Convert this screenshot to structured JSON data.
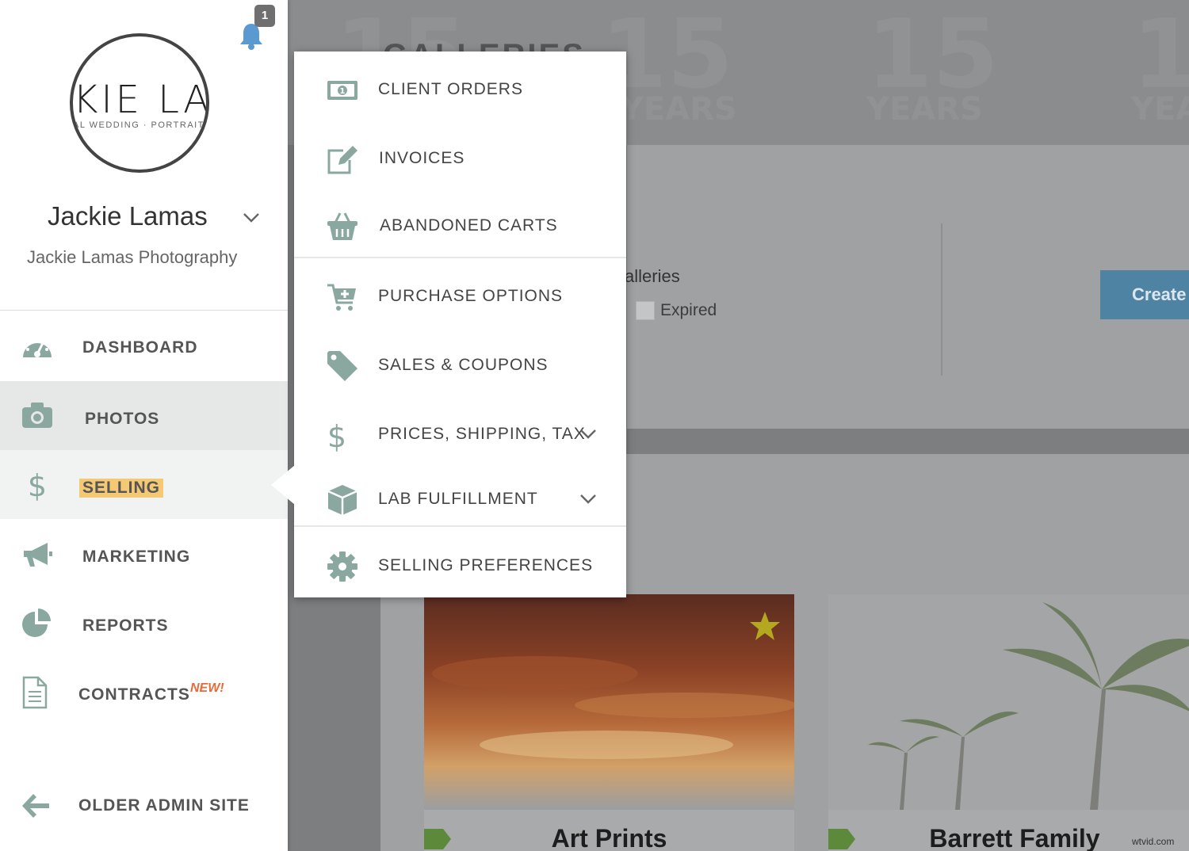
{
  "notifications": {
    "count": "1"
  },
  "profile": {
    "logo_text": "KIE LA",
    "logo_sub": "AL WEDDING · PORTRAIT P",
    "name": "Jackie Lamas",
    "company": "Jackie Lamas Photography"
  },
  "sidebar": {
    "items": [
      {
        "label": "DASHBOARD",
        "icon": "dashboard-icon"
      },
      {
        "label": "PHOTOS",
        "icon": "camera-icon"
      },
      {
        "label": "SELLING",
        "icon": "dollar-icon"
      },
      {
        "label": "MARKETING",
        "icon": "megaphone-icon"
      },
      {
        "label": "REPORTS",
        "icon": "pie-chart-icon"
      },
      {
        "label": "CONTRACTS",
        "icon": "document-icon",
        "badge": "NEW!"
      }
    ],
    "older_admin": "OLDER ADMIN SITE"
  },
  "selling_menu": {
    "items": [
      {
        "label": "CLIENT ORDERS",
        "icon": "money-icon"
      },
      {
        "label": "INVOICES",
        "icon": "edit-icon"
      },
      {
        "label": "ABANDONED CARTS",
        "icon": "basket-icon"
      },
      {
        "label": "PURCHASE OPTIONS",
        "icon": "cart-plus-icon"
      },
      {
        "label": "SALES & COUPONS",
        "icon": "tag-icon"
      },
      {
        "label": "PRICES, SHIPPING, TAX",
        "icon": "dollar-icon",
        "expandable": true
      },
      {
        "label": "LAB FULFILLMENT",
        "icon": "box-icon",
        "expandable": true
      },
      {
        "label": "SELLING PREFERENCES",
        "icon": "gear-icon"
      }
    ]
  },
  "background": {
    "heading_partial": "GALLERIES",
    "watermark_number": "15",
    "watermark_word": "YEARS",
    "filter_label": "alleries",
    "expired_label": "Expired",
    "create_button": "Create",
    "cards": [
      {
        "title": "Art Prints",
        "starred": true
      },
      {
        "title": "Barrett Family",
        "starred": false
      }
    ]
  },
  "credit": "wtvid.com",
  "colors": {
    "accent_icon": "#8aa8a0",
    "highlight": "#f5c874",
    "new_badge": "#e66a3a",
    "create_button": "#4e83a3",
    "bell": "#5b9ad0"
  }
}
